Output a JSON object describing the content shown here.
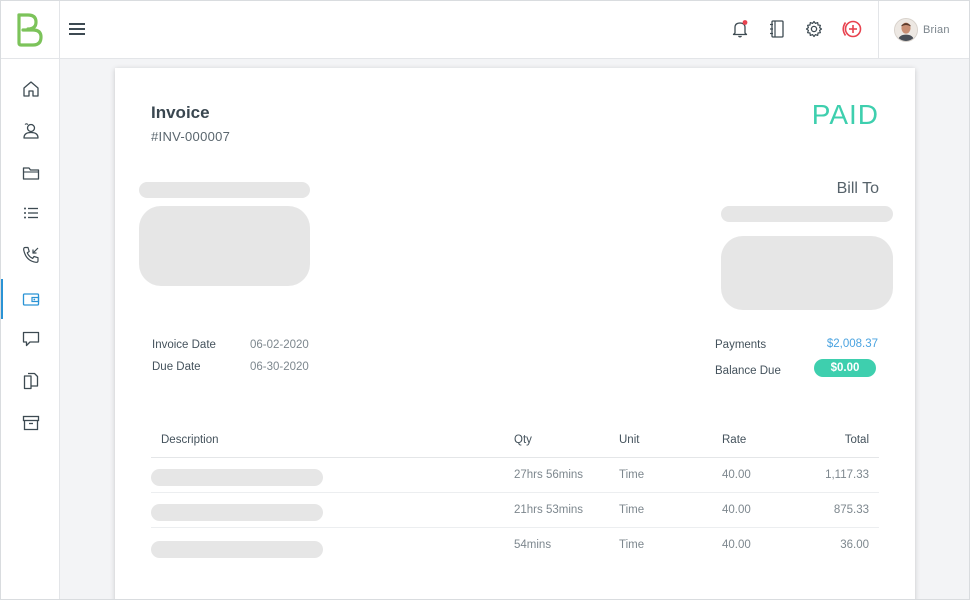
{
  "app": {
    "brand_letter": "B",
    "brand_color": "#7cc35a",
    "user": {
      "name": "Brian"
    }
  },
  "topbar": {
    "icons": [
      "bell-icon",
      "notebook-icon",
      "gear-icon",
      "add-circle-icon"
    ]
  },
  "sidebar": {
    "items": [
      {
        "icon": "home-icon",
        "active": false
      },
      {
        "icon": "contacts-icon",
        "active": false
      },
      {
        "icon": "folder-icon",
        "active": false
      },
      {
        "icon": "list-icon",
        "active": false
      },
      {
        "icon": "phone-incoming-icon",
        "active": false
      },
      {
        "icon": "wallet-icon",
        "active": true
      },
      {
        "icon": "chat-icon",
        "active": false
      },
      {
        "icon": "documents-icon",
        "active": false
      },
      {
        "icon": "archive-icon",
        "active": false
      }
    ]
  },
  "invoice": {
    "title": "Invoice",
    "number": "#INV-000007",
    "status": "PAID",
    "bill_to_label": "Bill To",
    "dates": {
      "invoice_date_label": "Invoice Date",
      "invoice_date": "06-02-2020",
      "due_date_label": "Due Date",
      "due_date": "06-30-2020"
    },
    "summary": {
      "payments_label": "Payments",
      "payments": "$2,008.37",
      "balance_label": "Balance Due",
      "balance": "$0.00"
    },
    "table": {
      "headers": {
        "description": "Description",
        "qty": "Qty",
        "unit": "Unit",
        "rate": "Rate",
        "total": "Total"
      },
      "rows": [
        {
          "qty": "27hrs  56mins",
          "unit": "Time",
          "rate": "40.00",
          "total": "1,117.33"
        },
        {
          "qty": "21hrs  53mins",
          "unit": "Time",
          "rate": "40.00",
          "total": "875.33"
        },
        {
          "qty": "54mins",
          "unit": "Time",
          "rate": "40.00",
          "total": "36.00"
        }
      ]
    }
  },
  "colors": {
    "accent_green": "#3ecfae",
    "link_blue": "#4aa3e0",
    "alert_red": "#e8424f",
    "active_indicator": "#2a93d5"
  }
}
